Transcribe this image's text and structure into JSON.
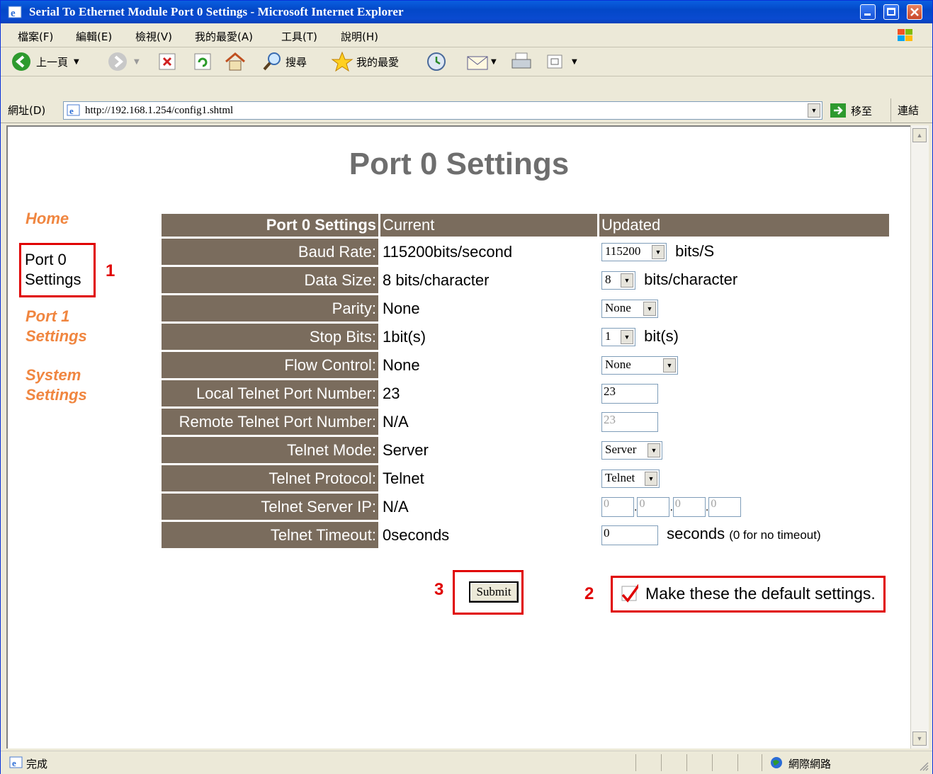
{
  "window": {
    "title": "Serial To Ethernet Module Port 0 Settings - Microsoft Internet Explorer"
  },
  "menu": [
    "檔案(F)",
    "編輯(E)",
    "檢視(V)",
    "我的最愛(A)",
    "工具(T)",
    "說明(H)"
  ],
  "toolbar": {
    "back": "上一頁",
    "search": "搜尋",
    "favorites": "我的最愛"
  },
  "address": {
    "label": "網址(D)",
    "url": "http://192.168.1.254/config1.shtml",
    "go": "移至",
    "links": "連結"
  },
  "status": {
    "text": "完成",
    "zone": "網際網路"
  },
  "page": {
    "title": "Port 0 Settings",
    "nav": {
      "home": "Home",
      "port0": "Port 0 Settings",
      "port1": "Port 1 Settings",
      "system": "System Settings"
    },
    "table": {
      "header_label": "Port 0 Settings",
      "header_current": "Current",
      "header_updated": "Updated",
      "rows": [
        {
          "label": "Baud Rate:",
          "current": "115200bits/second",
          "value": "115200",
          "unit": "bits/S"
        },
        {
          "label": "Data Size:",
          "current": "8 bits/character",
          "value": "8",
          "unit": "bits/character"
        },
        {
          "label": "Parity:",
          "current": "None",
          "value": "None"
        },
        {
          "label": "Stop Bits:",
          "current": "1bit(s)",
          "value": "1",
          "unit": "bit(s)"
        },
        {
          "label": "Flow Control:",
          "current": "None",
          "value": "None"
        },
        {
          "label": "Local Telnet Port Number:",
          "current": "23",
          "value": "23"
        },
        {
          "label": "Remote Telnet Port Number:",
          "current": "N/A",
          "value": "23"
        },
        {
          "label": "Telnet Mode:",
          "current": "Server",
          "value": "Server"
        },
        {
          "label": "Telnet Protocol:",
          "current": "Telnet",
          "value": "Telnet"
        },
        {
          "label": "Telnet Server IP:",
          "current": "N/A",
          "ip": [
            "0",
            "0",
            "0",
            "0"
          ]
        },
        {
          "label": "Telnet Timeout:",
          "current": "0seconds",
          "value": "0",
          "unit": "seconds",
          "note": "(0 for no timeout)"
        }
      ]
    },
    "submit": "Submit",
    "default_checkbox": {
      "label": "Make these the default settings.",
      "checked": true
    },
    "annotations": [
      "1",
      "2",
      "3"
    ]
  }
}
